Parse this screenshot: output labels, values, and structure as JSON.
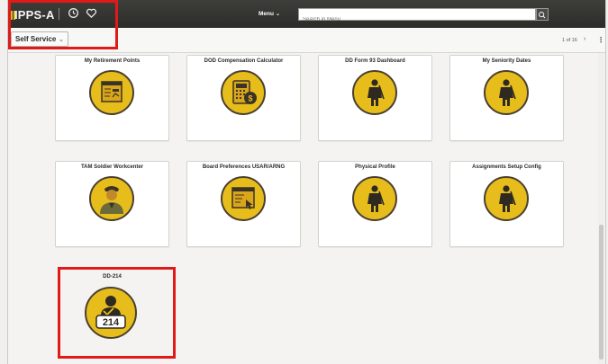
{
  "app": {
    "logo": "IPPS-A"
  },
  "header": {
    "menu_label": "Menu",
    "search_placeholder": "Search in Menu",
    "icons": [
      "history-icon",
      "favorites-icon",
      "search-icon"
    ]
  },
  "subheader": {
    "page_title": "Self Service",
    "pager": "1 of 16"
  },
  "tiles": [
    {
      "title": "My Retirement Points",
      "icon": "retirement-points-icon"
    },
    {
      "title": "DOD Compensation Calculator",
      "icon": "calculator-icon"
    },
    {
      "title": "DD Form 93 Dashboard",
      "icon": "soldier-icon"
    },
    {
      "title": "My Seniority Dates",
      "icon": "soldier-icon"
    },
    {
      "title": "TAM Soldier Workcenter",
      "icon": "soldier-portrait-icon"
    },
    {
      "title": "Board Preferences USAR/ARNG",
      "icon": "board-preferences-icon"
    },
    {
      "title": "Physical Profile",
      "icon": "soldier-icon"
    },
    {
      "title": "Assignments Setup Config",
      "icon": "soldier-icon"
    },
    {
      "title": "DD-214",
      "icon": "dd214-icon",
      "badge_text": "214"
    }
  ],
  "colors": {
    "accent": "#e7bd1c",
    "highlight": "#e11919",
    "topbar": "#2f2f2c"
  }
}
